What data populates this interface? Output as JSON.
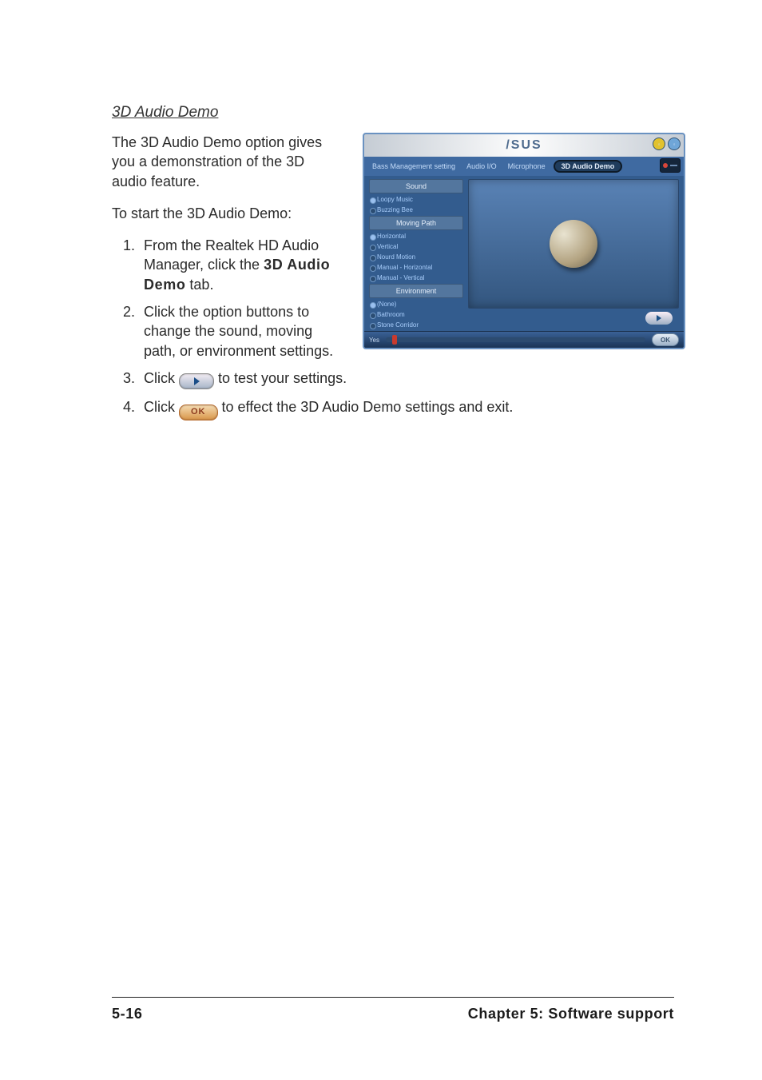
{
  "section_title": "3D Audio Demo",
  "intro_para": "The 3D Audio Demo option gives you a demonstration of the 3D audio feature.",
  "start_para": "To start the 3D Audio Demo:",
  "steps": {
    "s1_pre": "From the Realtek HD Audio Manager, click the ",
    "s1_bold": "3D Audio Demo",
    "s1_post": " tab.",
    "s2": "Click the option buttons to change the sound, moving path, or environment settings.",
    "s3_pre": "Click ",
    "s3_post": " to test your settings.",
    "s4_pre": "Click ",
    "s4_post": " to effect the 3D Audio Demo settings and exit."
  },
  "screenshot": {
    "brand": "/SUS",
    "tabs": [
      "Bass Management setting",
      "Audio I/O",
      "Microphone",
      "3D Audio Demo"
    ],
    "groups": {
      "sound": {
        "header": "Sound",
        "options": [
          "Loopy Music",
          "Buzzing Bee"
        ]
      },
      "moving": {
        "header": "Moving Path",
        "options": [
          "Horizontal",
          "Vertical",
          "Nourd Motion",
          "Manual - Horizontal",
          "Manual - Vertical"
        ]
      },
      "env": {
        "header": "Environment",
        "options": [
          "(None)",
          "Bathroom",
          "Stone Corridor"
        ]
      }
    },
    "ok_label": "OK",
    "footer_left": "Yes"
  },
  "inline_ok_label": "OK",
  "footer": {
    "page": "5-16",
    "chapter": "Chapter 5: Software support"
  }
}
